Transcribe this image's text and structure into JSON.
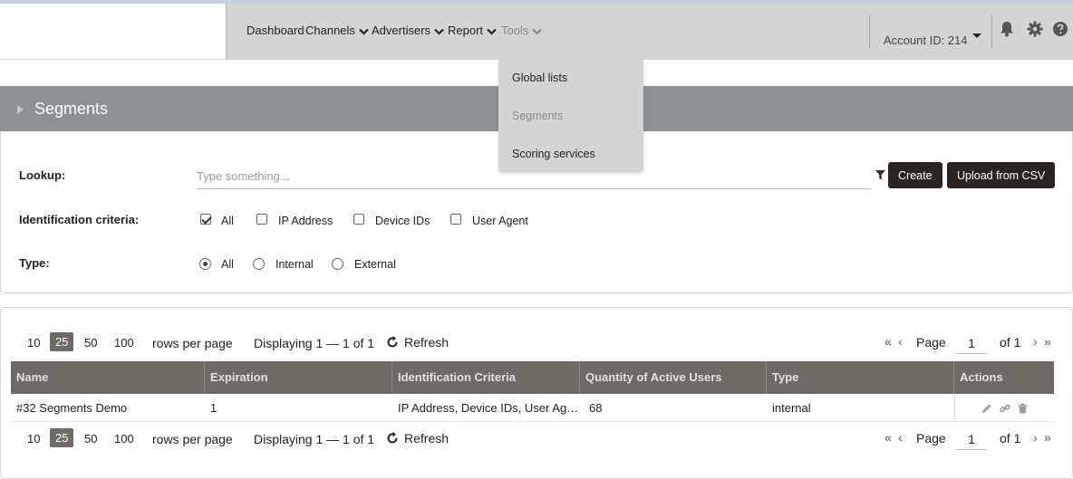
{
  "nav": {
    "items": [
      {
        "label": "Dashboard",
        "has_chevron": false
      },
      {
        "label": "Channels",
        "has_chevron": true
      },
      {
        "label": "Advertisers",
        "has_chevron": true
      },
      {
        "label": "Report",
        "has_chevron": true
      },
      {
        "label": "Tools",
        "has_chevron": true,
        "active": true
      }
    ],
    "account_label": "Account ID: 214",
    "icons": [
      "bell-icon",
      "gear-icon",
      "help-icon"
    ]
  },
  "tools_menu": {
    "items": [
      {
        "label": "Global lists",
        "disabled": false
      },
      {
        "label": "Segments",
        "disabled": true
      },
      {
        "label": "Scoring services",
        "disabled": false
      }
    ]
  },
  "section": {
    "title": "Segments"
  },
  "filters": {
    "lookup_label": "Lookup:",
    "lookup_placeholder": "Type something...",
    "lookup_value": "",
    "create_label": "Create",
    "upload_label": "Upload from CSV",
    "ident_label": "Identification criteria:",
    "ident_options": [
      {
        "label": "All",
        "checked": true
      },
      {
        "label": "IP Address",
        "checked": false
      },
      {
        "label": "Device IDs",
        "checked": false
      },
      {
        "label": "User Agent",
        "checked": false
      }
    ],
    "type_label": "Type:",
    "type_options": [
      {
        "label": "All",
        "checked": true
      },
      {
        "label": "Internal",
        "checked": false
      },
      {
        "label": "External",
        "checked": false
      }
    ]
  },
  "pager": {
    "sizes": [
      "10",
      "25",
      "50",
      "100"
    ],
    "active_size": "25",
    "rows_per_page": "rows per page",
    "displaying": "Displaying 1 — 1 of 1",
    "refresh": "Refresh",
    "page_label": "Page",
    "page_value": "1",
    "of_label": "of 1"
  },
  "table": {
    "columns": [
      "Name",
      "Expiration",
      "Identification Criteria",
      "Quantity of Active Users",
      "Type",
      "Actions"
    ],
    "rows": [
      {
        "name": "#32 Segments Demo",
        "expiration": "1",
        "criteria": "IP Address, Device IDs, User Agent",
        "quantity": "68",
        "type": "internal"
      }
    ]
  },
  "colors": {
    "nav_bg": "#d4d4d4",
    "section_bar": "#8e9194",
    "table_header": "#6e6a66",
    "button_dark": "#2a2521"
  }
}
